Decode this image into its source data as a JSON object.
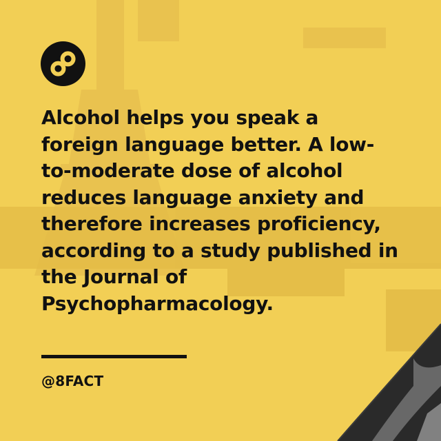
{
  "post": {
    "fact_text": "Alcohol helps you speak a foreign language better. A low-to-moderate dose of alcohol reduces language anxiety and therefore increases proficiency, according to a study published in the Journal of Psychopharmacology.",
    "handle": "@8FACT"
  },
  "brand": {
    "logo_icon": "infinity-8-icon",
    "accent_color": "#f2cf55",
    "text_color": "#111111"
  }
}
